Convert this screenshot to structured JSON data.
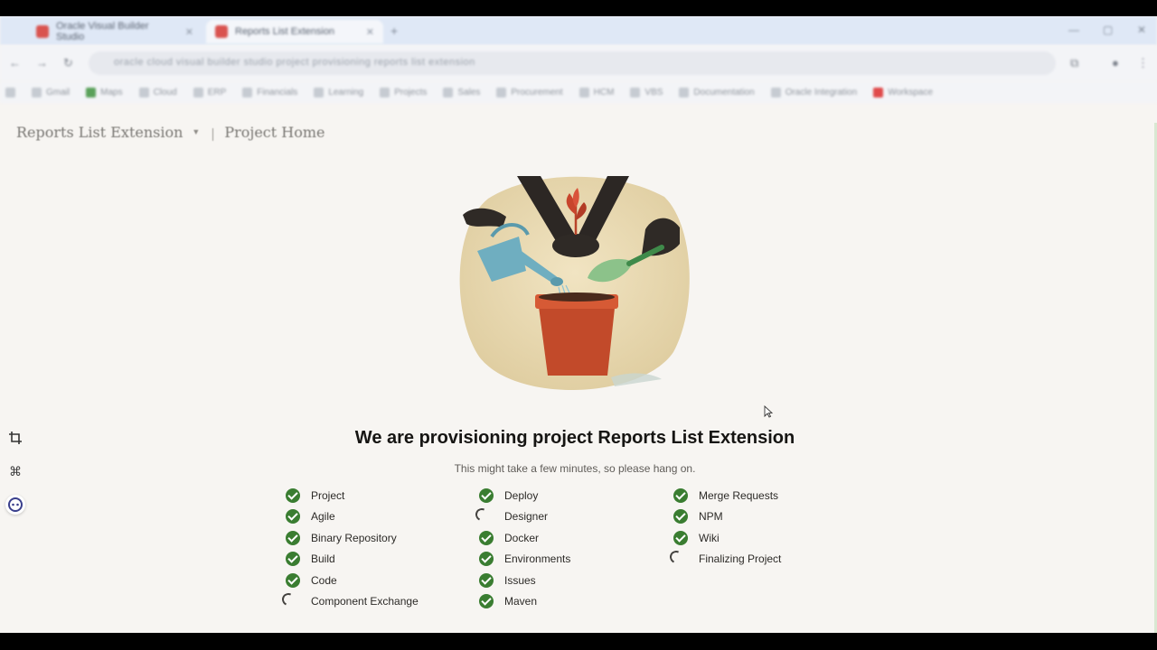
{
  "browser": {
    "tabs": [
      {
        "title": "Oracle Visual Builder Studio",
        "active": false
      },
      {
        "title": "Reports List Extension",
        "active": true
      }
    ],
    "new_tab_icon": "plus-icon",
    "address_url": "oracle cloud visual builder studio project provisioning reports list extension",
    "bookmarks": [
      "Gmail",
      "Maps",
      "Cloud",
      "ERP",
      "Financials",
      "Learning",
      "Projects",
      "Sales",
      "Procurement",
      "HCM",
      "VBS",
      "Documentation",
      "Oracle Integration",
      "Workspace"
    ]
  },
  "header": {
    "project_name": "Reports List Extension",
    "breadcrumb_page": "Project Home"
  },
  "main": {
    "title": "We are provisioning project Reports List Extension",
    "subtitle": "This might take a few minutes, so please hang on."
  },
  "colors": {
    "done": "#3a7d31",
    "background": "#f7f5f2",
    "pot": "#c24a2a",
    "watering_can": "#6faec0"
  },
  "provisioning": {
    "columns": [
      [
        {
          "label": "Project",
          "status": "done"
        },
        {
          "label": "Agile",
          "status": "done"
        },
        {
          "label": "Binary Repository",
          "status": "done"
        },
        {
          "label": "Build",
          "status": "done"
        },
        {
          "label": "Code",
          "status": "done"
        },
        {
          "label": "Component Exchange",
          "status": "pending"
        }
      ],
      [
        {
          "label": "Deploy",
          "status": "done"
        },
        {
          "label": "Designer",
          "status": "pending"
        },
        {
          "label": "Docker",
          "status": "done"
        },
        {
          "label": "Environments",
          "status": "done"
        },
        {
          "label": "Issues",
          "status": "done"
        },
        {
          "label": "Maven",
          "status": "done"
        }
      ],
      [
        {
          "label": "Merge Requests",
          "status": "done"
        },
        {
          "label": "NPM",
          "status": "done"
        },
        {
          "label": "Wiki",
          "status": "done"
        },
        {
          "label": "Finalizing Project",
          "status": "pending"
        }
      ]
    ]
  },
  "side_tools": [
    "crop-icon",
    "command-icon",
    "assistant-icon"
  ]
}
